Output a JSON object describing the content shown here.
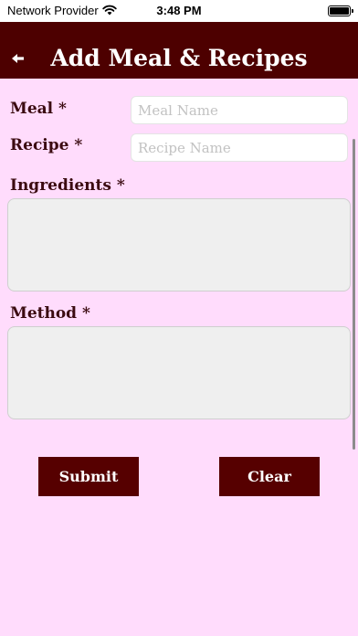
{
  "status_bar": {
    "carrier": "Network Provider",
    "time": "3:48 PM",
    "battery_level": 1.0
  },
  "header": {
    "title": "Add Meal & Recipes",
    "back_icon": "back-arrow-icon"
  },
  "form": {
    "meal_label": "Meal *",
    "meal_placeholder": "Meal Name",
    "meal_value": "",
    "recipe_label": "Recipe *",
    "recipe_placeholder": "Recipe Name",
    "recipe_value": "",
    "ingredients_label": "Ingredients *",
    "ingredients_value": "",
    "method_label": "Method *",
    "method_value": ""
  },
  "actions": {
    "submit_label": "Submit",
    "clear_label": "Clear"
  },
  "colors": {
    "background": "#ffdcfc",
    "header": "#4d0000",
    "button": "#560000",
    "label_text": "#3b0b11"
  }
}
